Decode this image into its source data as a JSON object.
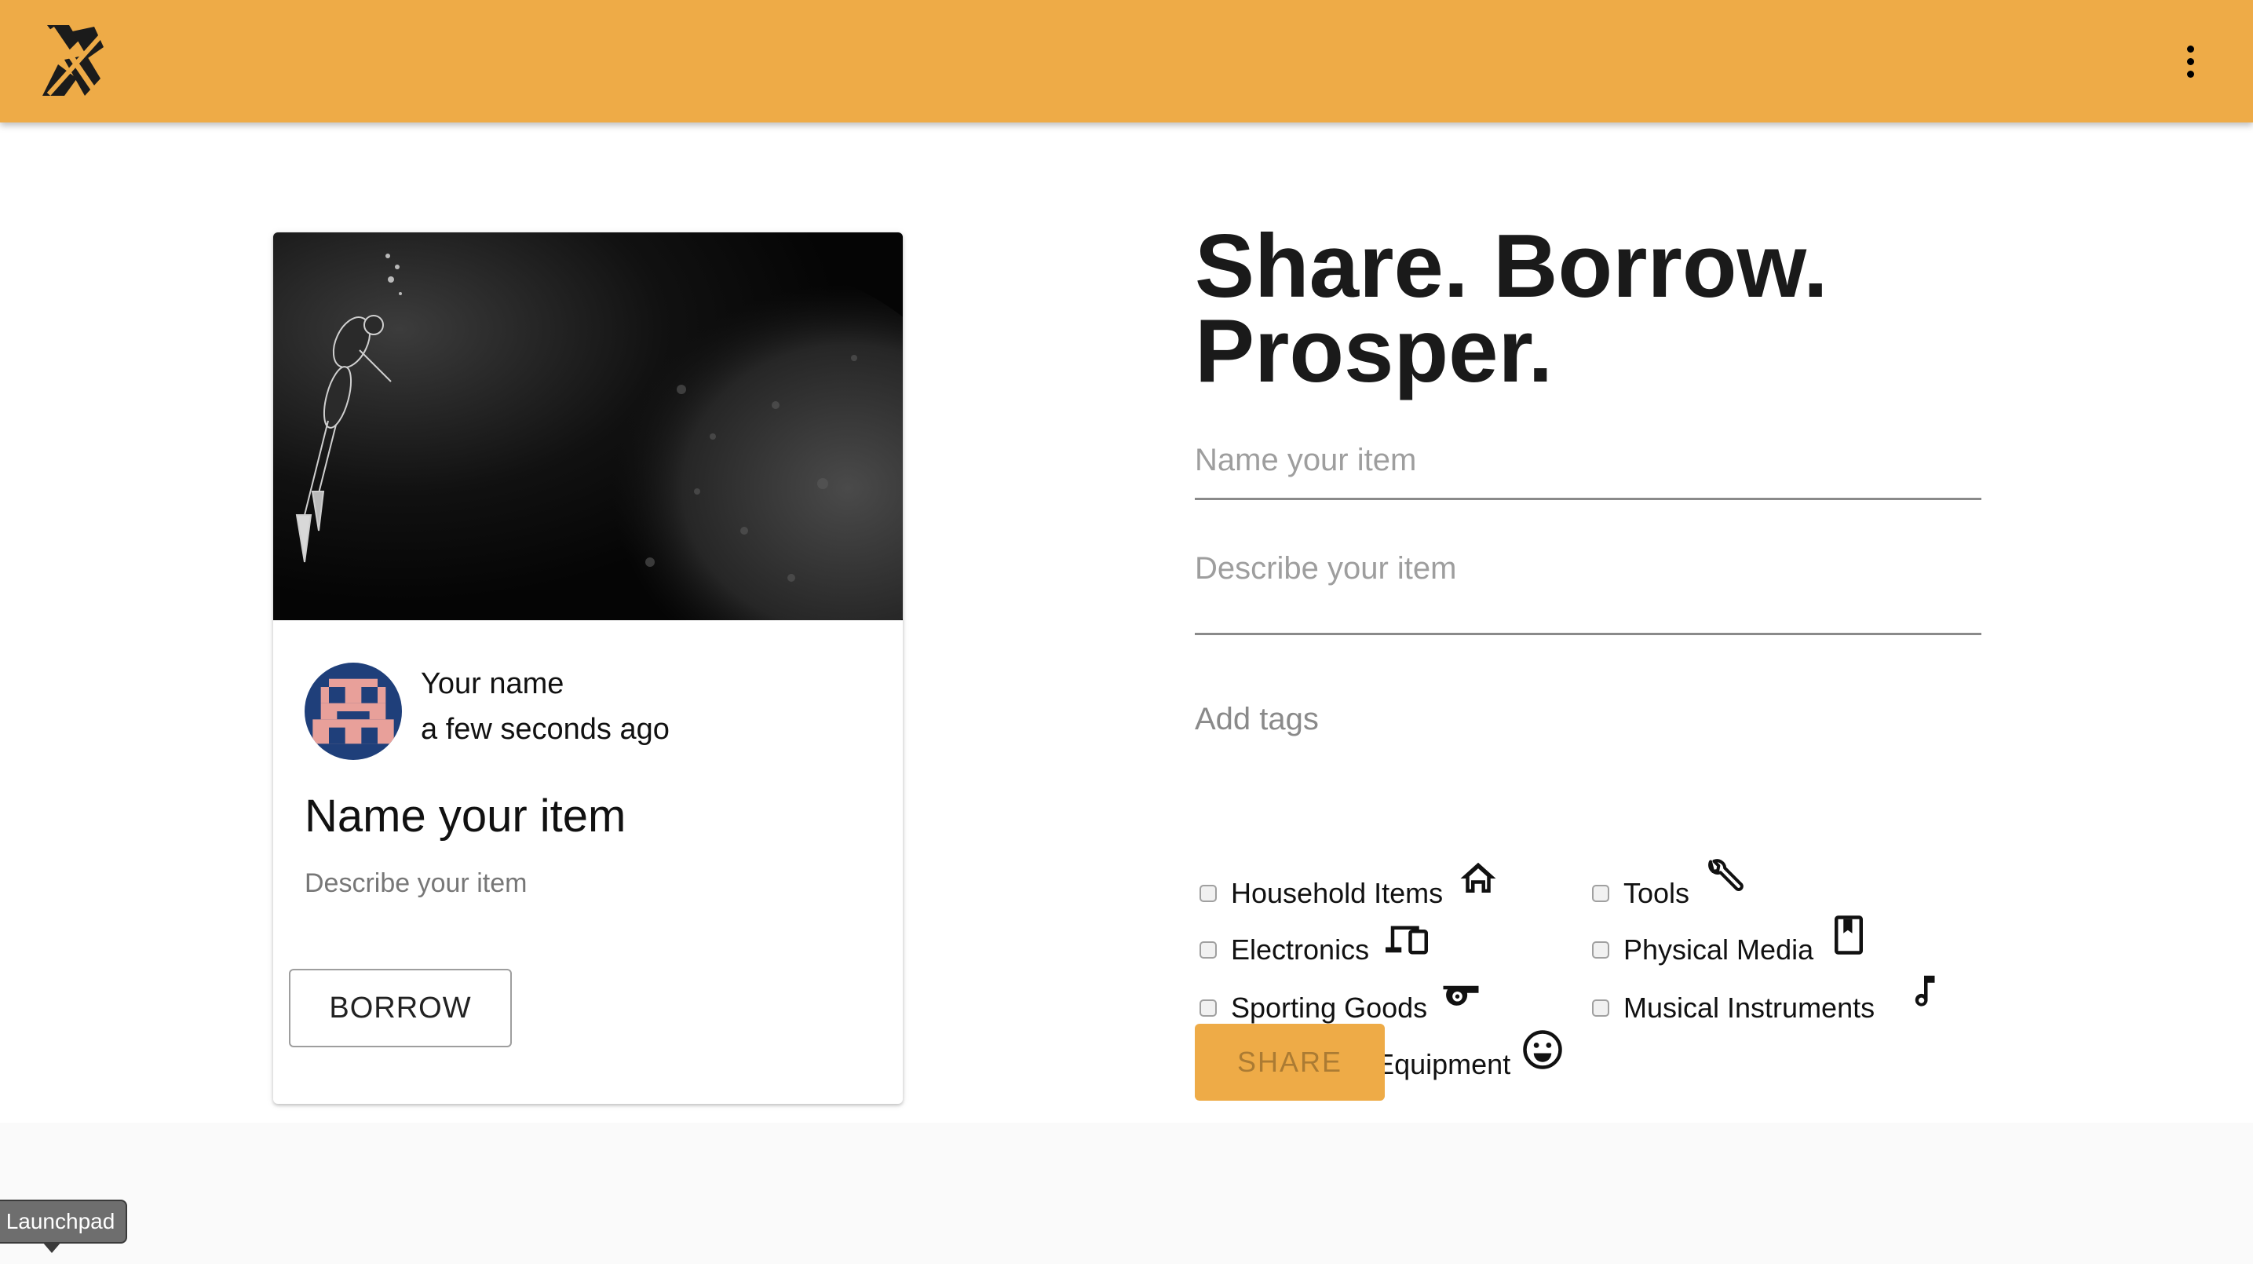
{
  "app": {
    "logo_icon": "boomtown-logo-icon",
    "menu_icon": "more-vertical-icon",
    "header_color": "#eeab47"
  },
  "preview_card": {
    "image": "scuba-diver-underwater-photo",
    "owner_name": "Your name",
    "timestamp": "a few seconds ago",
    "item_title": "Name your item",
    "item_description": "Describe your item",
    "borrow_label": "BORROW"
  },
  "share_form": {
    "headline_line1": "Share. Borrow.",
    "headline_line2": "Prosper.",
    "name_placeholder": "Name your item",
    "name_value": "",
    "description_placeholder": "Describe your item",
    "description_value": "",
    "tags_label": "Add tags",
    "tags": [
      {
        "label": "Household Items",
        "icon": "home-icon",
        "checked": false
      },
      {
        "label": "Tools",
        "icon": "wrench-icon",
        "checked": false
      },
      {
        "label": "Electronics",
        "icon": "devices-icon",
        "checked": false
      },
      {
        "label": "Physical Media",
        "icon": "book-icon",
        "checked": false
      },
      {
        "label": "Sporting Goods",
        "icon": "whistle-icon",
        "checked": false
      },
      {
        "label": "Musical Instruments",
        "icon": "music-note-icon",
        "checked": false
      },
      {
        "label": "Recreation Equipment",
        "icon": "smiley-icon",
        "checked": false
      }
    ],
    "share_label": "SHARE",
    "accent_color": "#eeab47"
  },
  "os": {
    "tooltip_label": "Launchpad"
  }
}
